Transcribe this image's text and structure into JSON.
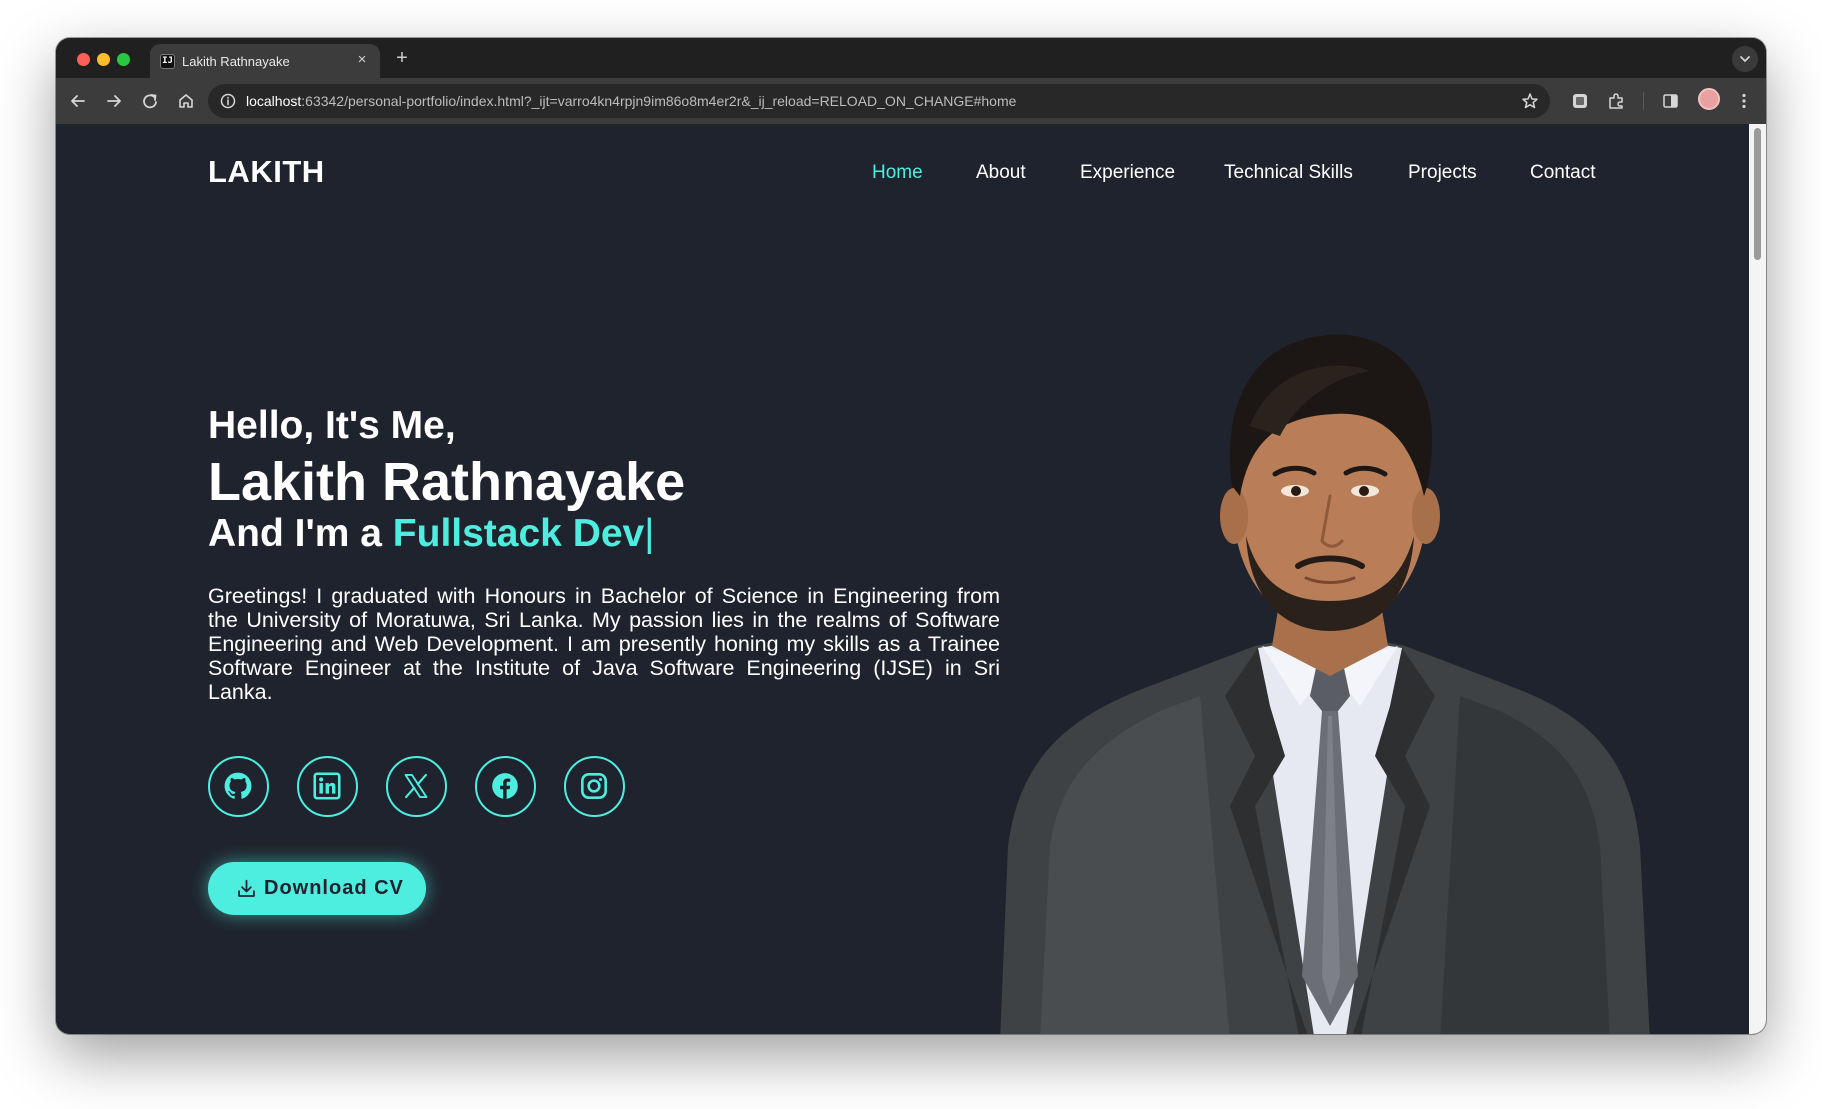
{
  "browser": {
    "tab_title": "Lakith Rathnayake",
    "favicon_text": "IJ",
    "close_glyph": "×",
    "newtab_glyph": "+",
    "url_host": "localhost",
    "url_rest": ":63342/personal-portfolio/index.html?_ijt=varro4kn4rpjn9im86o8m4er2r&_ij_reload=RELOAD_ON_CHANGE#home"
  },
  "site": {
    "logo": "LAKITH",
    "nav": [
      "Home",
      "About",
      "Experience",
      "Technical Skills",
      "Projects",
      "Contact"
    ],
    "active_nav": "Home"
  },
  "hero": {
    "greeting": "Hello, It's Me,",
    "name": "Lakith Rathnayake",
    "role_prefix": "And I'm a ",
    "role_highlight": "Fullstack Dev",
    "cursor": "|",
    "bio": "Greetings! I graduated with Honours in Bachelor of Science in Engineering from the University of Moratuwa, Sri Lanka. My passion lies in the realms of Software Engineering and Web Development. I am presently honing my skills as a Trainee Software Engineer at the Institute of Java Software Engineering (IJSE) in Sri Lanka.",
    "social_icons": [
      "github-icon",
      "linkedin-icon",
      "x-icon",
      "facebook-icon",
      "instagram-icon"
    ],
    "cv_button": "Download CV"
  },
  "colors": {
    "accent": "#4deee0",
    "page_bg": "#1f232d",
    "text": "#ffffff"
  }
}
